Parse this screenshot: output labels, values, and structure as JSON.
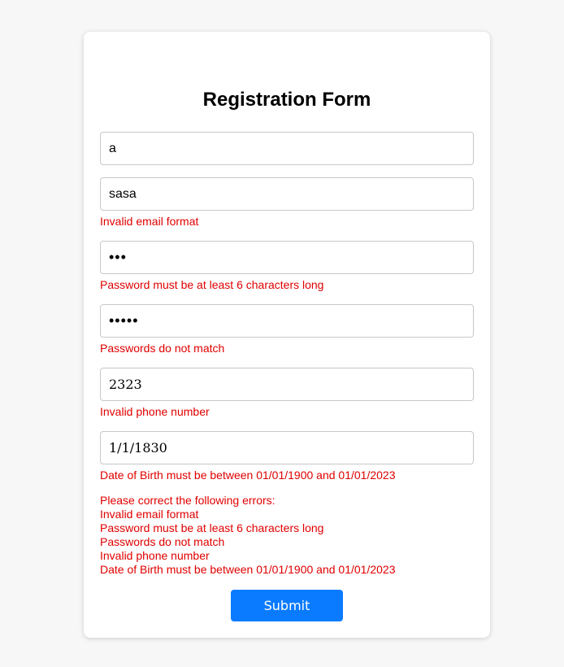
{
  "form": {
    "title": "Registration Form",
    "fields": {
      "name": {
        "value": "a"
      },
      "email": {
        "value": "sasa",
        "error": "Invalid email format"
      },
      "password": {
        "value": "abc",
        "error": "Password must be at least 6 characters long"
      },
      "confirm_password": {
        "value": "abcde",
        "error": "Passwords do not match"
      },
      "phone": {
        "value": "2323",
        "error": "Invalid phone number"
      },
      "dob": {
        "value": "1/1/1830",
        "error": "Date of Birth must be between 01/01/1900 and 01/01/2023"
      }
    },
    "summary": {
      "heading": "Please correct the following errors:",
      "items": [
        "Invalid email format",
        "Password must be at least 6 characters long",
        "Passwords do not match",
        "Invalid phone number",
        "Date of Birth must be between 01/01/1900 and 01/01/2023"
      ]
    },
    "submit_label": "Submit"
  },
  "colors": {
    "background": "#f7f7f7",
    "card": "#ffffff",
    "error": "#e00000",
    "primary": "#0a7bff"
  }
}
